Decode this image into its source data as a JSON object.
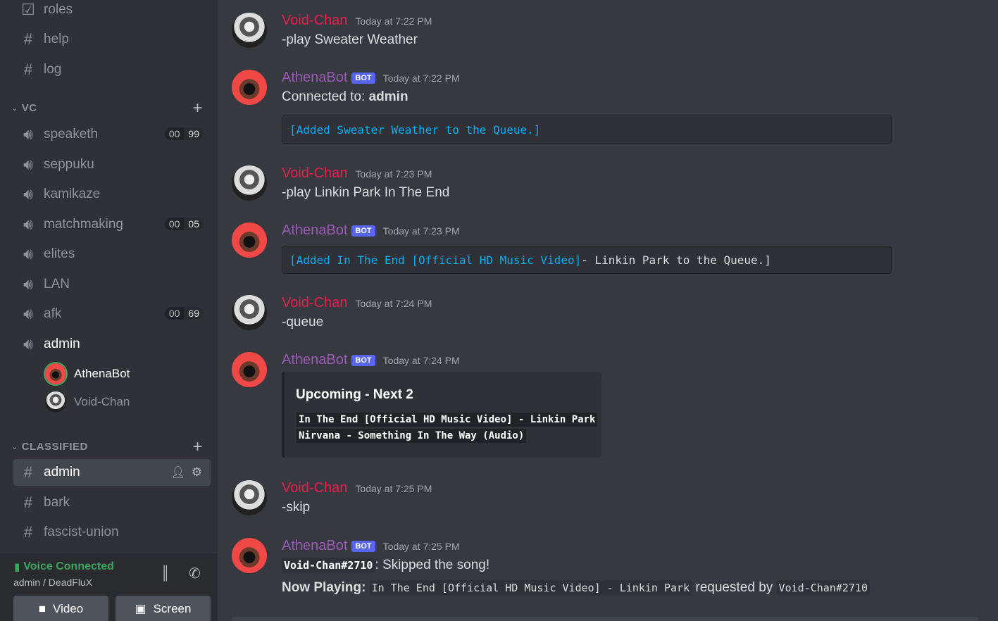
{
  "sidebar": {
    "top_channels": [
      {
        "icon": "rules-check-icon",
        "label": "roles"
      },
      {
        "icon": "hash-icon",
        "label": "help"
      },
      {
        "icon": "hash-icon",
        "label": "log"
      }
    ],
    "vc_category": "VC",
    "voice_channels": [
      {
        "label": "speaketh",
        "pill": [
          "00",
          "99"
        ]
      },
      {
        "label": "seppuku"
      },
      {
        "label": "kamikaze"
      },
      {
        "label": "matchmaking",
        "pill": [
          "00",
          "05"
        ]
      },
      {
        "label": "elites"
      },
      {
        "label": "LAN"
      },
      {
        "label": "afk",
        "pill": [
          "00",
          "69"
        ]
      },
      {
        "label": "admin"
      }
    ],
    "voice_members": [
      "AthenaBot",
      "Void-Chan"
    ],
    "classified_category": "CLASSIFIED",
    "classified_channels": [
      {
        "label": "admin",
        "active": true
      },
      {
        "label": "bark"
      },
      {
        "label": "fascist-union"
      }
    ],
    "voice_status": {
      "title": "Voice Connected",
      "subtitle": "admin / DeadFluX"
    },
    "buttons": {
      "video": "Video",
      "screen": "Screen"
    }
  },
  "messages": [
    {
      "user": "Void-Chan",
      "time": "Today at 7:22 PM",
      "text": "-play Sweater Weather"
    },
    {
      "user": "AthenaBot",
      "badge": "BOT",
      "time": "Today at 7:22 PM",
      "text_prefix": "Connected to: ",
      "text_bold": "admin",
      "code_link": "[Added Sweater Weather to the Queue.]"
    },
    {
      "user": "Void-Chan",
      "time": "Today at 7:23 PM",
      "text": "-play Linkin Park In The End"
    },
    {
      "user": "AthenaBot",
      "badge": "BOT",
      "time": "Today at 7:23 PM",
      "code_link": "[Added In The End [Official HD Music Video]",
      "code_plain": " - Linkin Park to the Queue.]"
    },
    {
      "user": "Void-Chan",
      "time": "Today at 7:24 PM",
      "text": "-queue"
    },
    {
      "user": "AthenaBot",
      "badge": "BOT",
      "time": "Today at 7:24 PM",
      "embed": {
        "title": "Upcoming - Next 2",
        "lines": [
          "In The End [Official HD Music Video] - Linkin Park",
          "Nirvana - Something In The Way (Audio)"
        ]
      }
    },
    {
      "user": "Void-Chan",
      "time": "Today at 7:25 PM",
      "text": "-skip"
    },
    {
      "user": "AthenaBot",
      "badge": "BOT",
      "time": "Today at 7:25 PM",
      "mention": "Void-Chan#2710",
      "after_mention": ": Skipped the song!",
      "now_label": "Now Playing:",
      "now_song": "In The End [Official HD Music Video] - Linkin Park",
      "requested": "requested by",
      "requester": "Void-Chan#2710"
    }
  ]
}
